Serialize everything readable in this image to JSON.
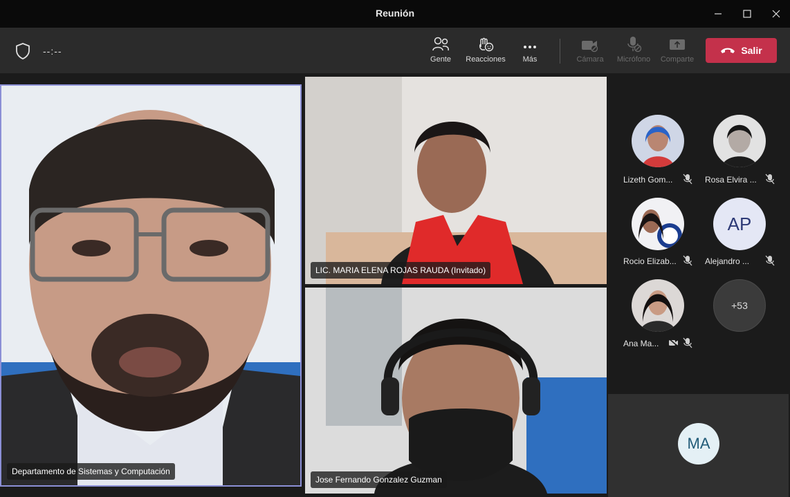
{
  "window": {
    "title": "Reunión"
  },
  "toolbar": {
    "timer": "--:--",
    "people_label": "Gente",
    "reactions_label": "Reacciones",
    "more_label": "Más",
    "camera_label": "Cámara",
    "mic_label": "Micrófono",
    "share_label": "Comparte",
    "leave_label": "Salir"
  },
  "videos": {
    "main": {
      "name": "Departamento de Sistemas y Computación"
    },
    "top_right": {
      "name": "LIC. MARIA ELENA ROJAS RAUDA (Invitado)"
    },
    "bottom_right": {
      "name": "Jose Fernando Gonzalez Guzman"
    }
  },
  "participants": [
    {
      "name": "Lizeth Gom...",
      "muted": true
    },
    {
      "name": "Rosa Elvira ...",
      "muted": true
    },
    {
      "name": "Rocio Elizab...",
      "muted": true
    },
    {
      "name": "Alejandro ...",
      "initials": "AP",
      "muted": true
    },
    {
      "name": "Ana Ma...",
      "muted": true,
      "camera_off": true
    }
  ],
  "overflow_count": "+53",
  "self_view": {
    "initials": "MA"
  },
  "colors": {
    "leave": "#c4314b",
    "active_border": "#8b8fd6",
    "toolbar": "#2b2b2b"
  }
}
